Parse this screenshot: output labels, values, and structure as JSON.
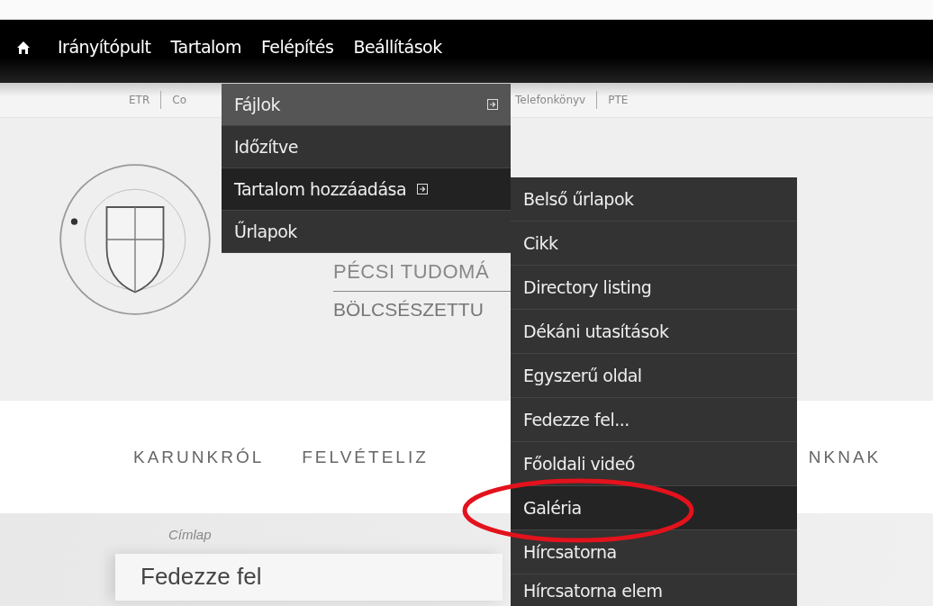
{
  "toolbar": {
    "items": [
      {
        "label": "Irányítópult"
      },
      {
        "label": "Tartalom"
      },
      {
        "label": "Felépítés"
      },
      {
        "label": "Beállítások"
      }
    ]
  },
  "top_links": [
    "ETR",
    "Co",
    "Telefonkönyv",
    "PTE"
  ],
  "header": {
    "title": "PÉCSI TUDOMÁ",
    "subtitle": "BÖLCSÉSZETTU"
  },
  "main_nav": [
    "KARUNKRÓL",
    "FELVÉTELIZ",
    "NKNAK"
  ],
  "breadcrumb": "Címlap",
  "card_title": "Fedezze fel",
  "menu": {
    "items": [
      {
        "label": "Fájlok",
        "has_submenu": true,
        "hovered": true,
        "expanded": false
      },
      {
        "label": "Időzítve",
        "has_submenu": false,
        "hovered": false,
        "expanded": false
      },
      {
        "label": "Tartalom hozzáadása",
        "has_submenu": true,
        "hovered": false,
        "expanded": true
      },
      {
        "label": "Űrlapok",
        "has_submenu": false,
        "hovered": false,
        "expanded": false
      }
    ]
  },
  "submenu": {
    "items": [
      {
        "label": "Belső űrlapok",
        "hovered": false
      },
      {
        "label": "Cikk",
        "hovered": false
      },
      {
        "label": "Directory listing",
        "hovered": false
      },
      {
        "label": "Dékáni utasítások",
        "hovered": false
      },
      {
        "label": "Egyszerű oldal",
        "hovered": false
      },
      {
        "label": "Fedezze fel...",
        "hovered": false
      },
      {
        "label": "Főoldali videó",
        "hovered": false
      },
      {
        "label": "Galéria",
        "hovered": true
      },
      {
        "label": "Hírcsatorna",
        "hovered": false
      },
      {
        "label": "Hírcsatorna elem",
        "hovered": false
      }
    ]
  }
}
